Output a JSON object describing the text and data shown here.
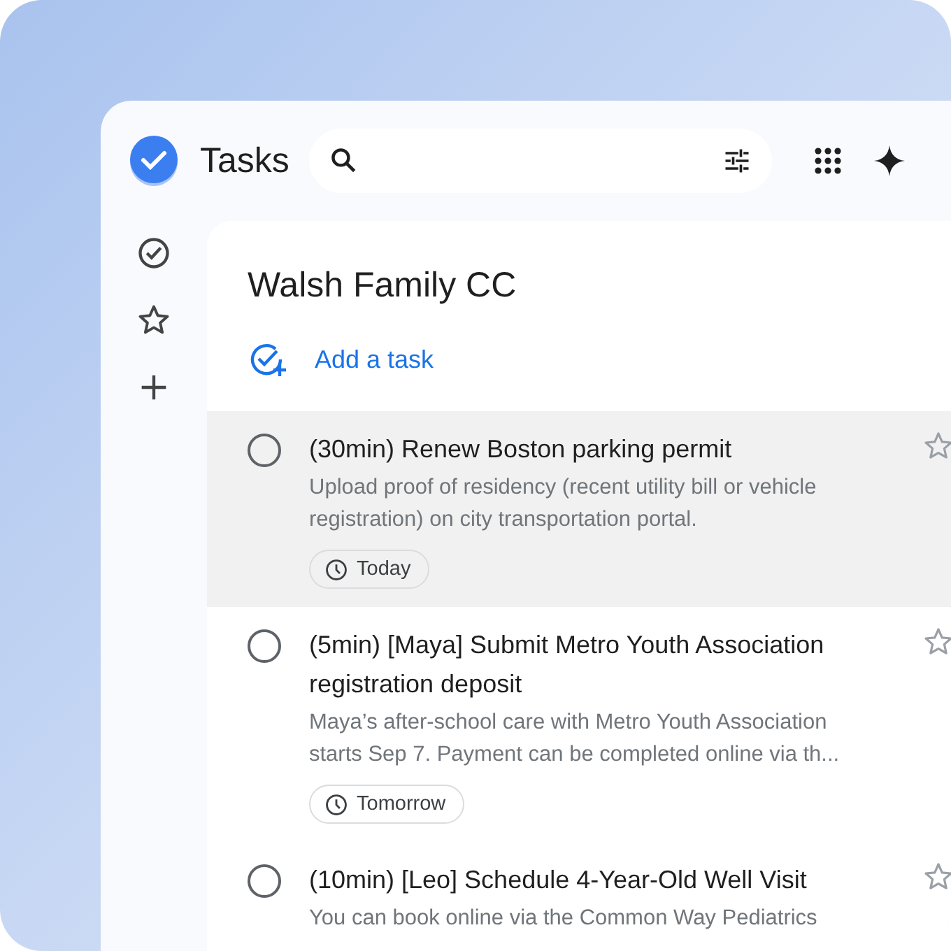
{
  "app": {
    "name": "Tasks"
  },
  "sidebar": {
    "items": [
      {
        "kind": "all",
        "selected": false
      },
      {
        "kind": "starred",
        "selected": false
      },
      {
        "kind": "new",
        "selected": false
      }
    ]
  },
  "list": {
    "title": "Walsh Family CC",
    "add_task": "Add a task"
  },
  "tasks": [
    {
      "title": "(30min) Renew Boston parking permit",
      "description": "Upload proof of residency (recent utility bill or vehicle registration) on city transportation portal.",
      "due": "Today",
      "selected": true,
      "starred": false
    },
    {
      "title": "(5min) [Maya] Submit Metro Youth Association registration deposit",
      "description": "Maya’s after-school care with Metro Youth Association starts Sep 7. Payment can be completed online via th...",
      "due": "Tomorrow",
      "selected": false,
      "starred": false
    },
    {
      "title": "(10min) [Leo] Schedule 4-Year-Old Well Visit",
      "description": "You can book online via the Common Way Pediatrics",
      "selected": false,
      "starred": false
    }
  ]
}
